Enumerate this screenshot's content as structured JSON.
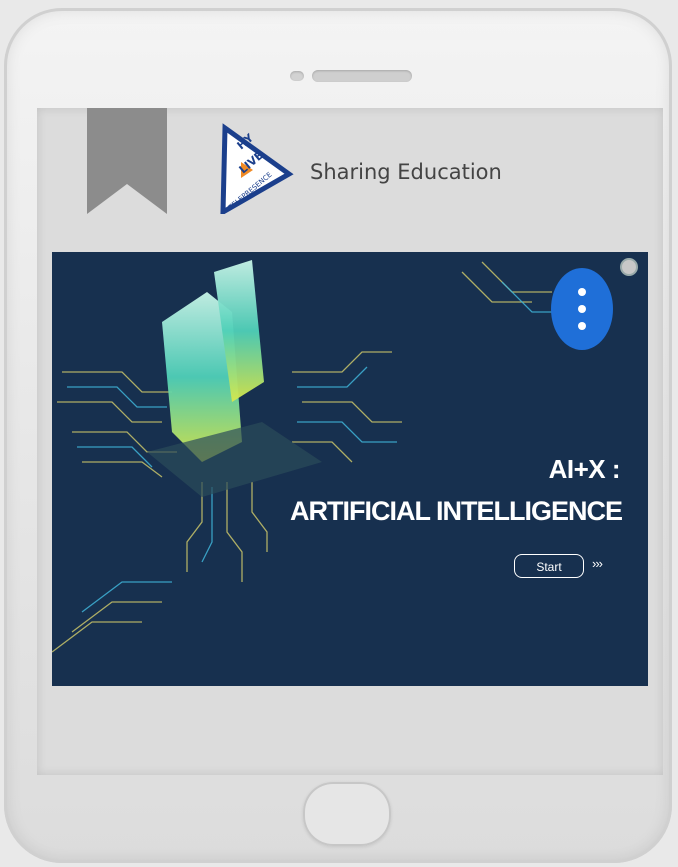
{
  "logo": {
    "text_1": "HY",
    "text_2": "LIVE",
    "text_3": "TELEPRESENCE"
  },
  "header": {
    "brand": "Sharing Education"
  },
  "banner": {
    "title_line_1": "AI+X :",
    "title_line_2": "ARTIFICIAL INTELLIGENCE",
    "start_label": "Start",
    "chevrons": "›››",
    "graphic_letters": "AI"
  },
  "colors": {
    "banner_bg": "#17304f",
    "menu_button": "#1f6fd8"
  },
  "icons": {
    "menu": "vertical-dots-icon",
    "bookmark": "bookmark-icon"
  }
}
